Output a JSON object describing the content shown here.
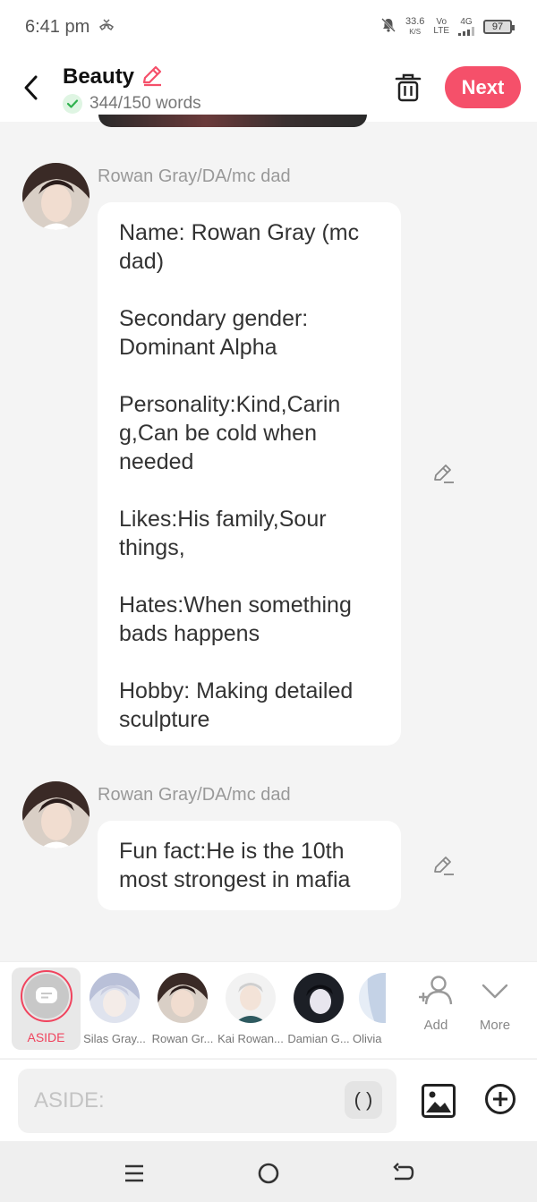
{
  "status_bar": {
    "time": "6:41 pm",
    "net_speed": "33.6",
    "net_unit": "K/S",
    "volte_top": "Vo",
    "volte_bottom": "LTE",
    "signal": "4G",
    "battery": "97"
  },
  "header": {
    "title": "Beauty",
    "word_count": "344/150 words",
    "next_label": "Next"
  },
  "messages": [
    {
      "speaker": "Rowan Gray/DA/mc dad",
      "text": "Name: Rowan Gray (mc dad)\n\nSecondary gender: Dominant Alpha\n\nPersonality:Kind,Carin g,Can be cold when needed\n\nLikes:His family,Sour things,\n\nHates:When something bads happens\n\nHobby: Making detailed sculpture"
    },
    {
      "speaker": "Rowan Gray/DA/mc dad",
      "text": "Fun fact:He is the 10th most strongest in mafia"
    }
  ],
  "character_bar": {
    "aside_label": "ASIDE",
    "characters": [
      {
        "name": "Silas Gray..."
      },
      {
        "name": "Rowan Gr..."
      },
      {
        "name": "Kai Rowan..."
      },
      {
        "name": "Damian G..."
      },
      {
        "name": "Olivia"
      }
    ],
    "add_label": "Add",
    "more_label": "More"
  },
  "input": {
    "placeholder": "ASIDE:",
    "paren_label": "( )"
  }
}
